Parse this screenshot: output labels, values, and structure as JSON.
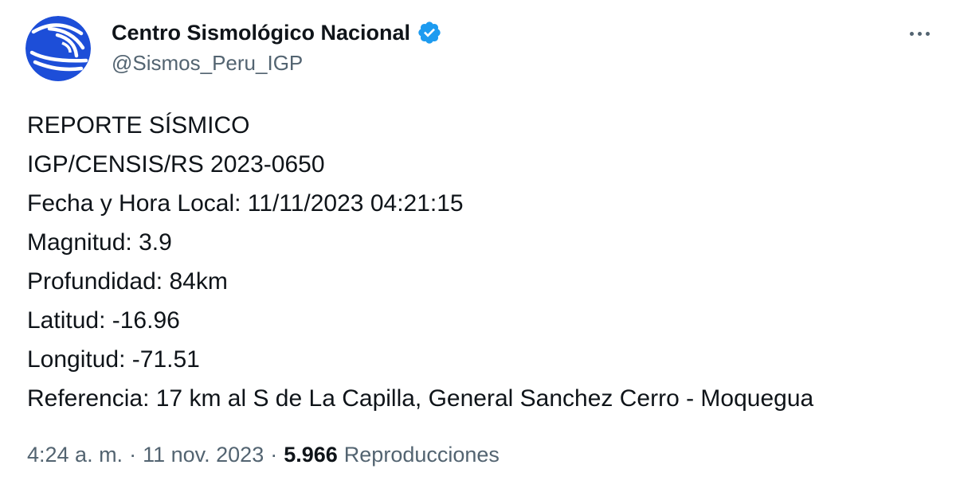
{
  "tweet": {
    "author": {
      "display_name": "Centro Sismológico Nacional",
      "handle": "@Sismos_Peru_IGP",
      "verified": true,
      "avatar_color": "#1d4ed8",
      "verified_color": "#1d9bf0"
    },
    "body_lines": [
      "REPORTE SÍSMICO",
      "IGP/CENSIS/RS 2023-0650",
      "Fecha y Hora Local: 11/11/2023 04:21:15",
      "Magnitud: 3.9",
      "Profundidad: 84km",
      "Latitud: -16.96",
      "Longitud: -71.51",
      "Referencia: 17 km al S de La Capilla, General Sanchez Cerro - Moquegua"
    ],
    "meta": {
      "time": "4:24 a. m.",
      "separator": "·",
      "date": "11 nov. 2023",
      "views_count": "5.966",
      "views_label": "Reproducciones"
    },
    "more_icon": "more-horizontal-icon"
  }
}
